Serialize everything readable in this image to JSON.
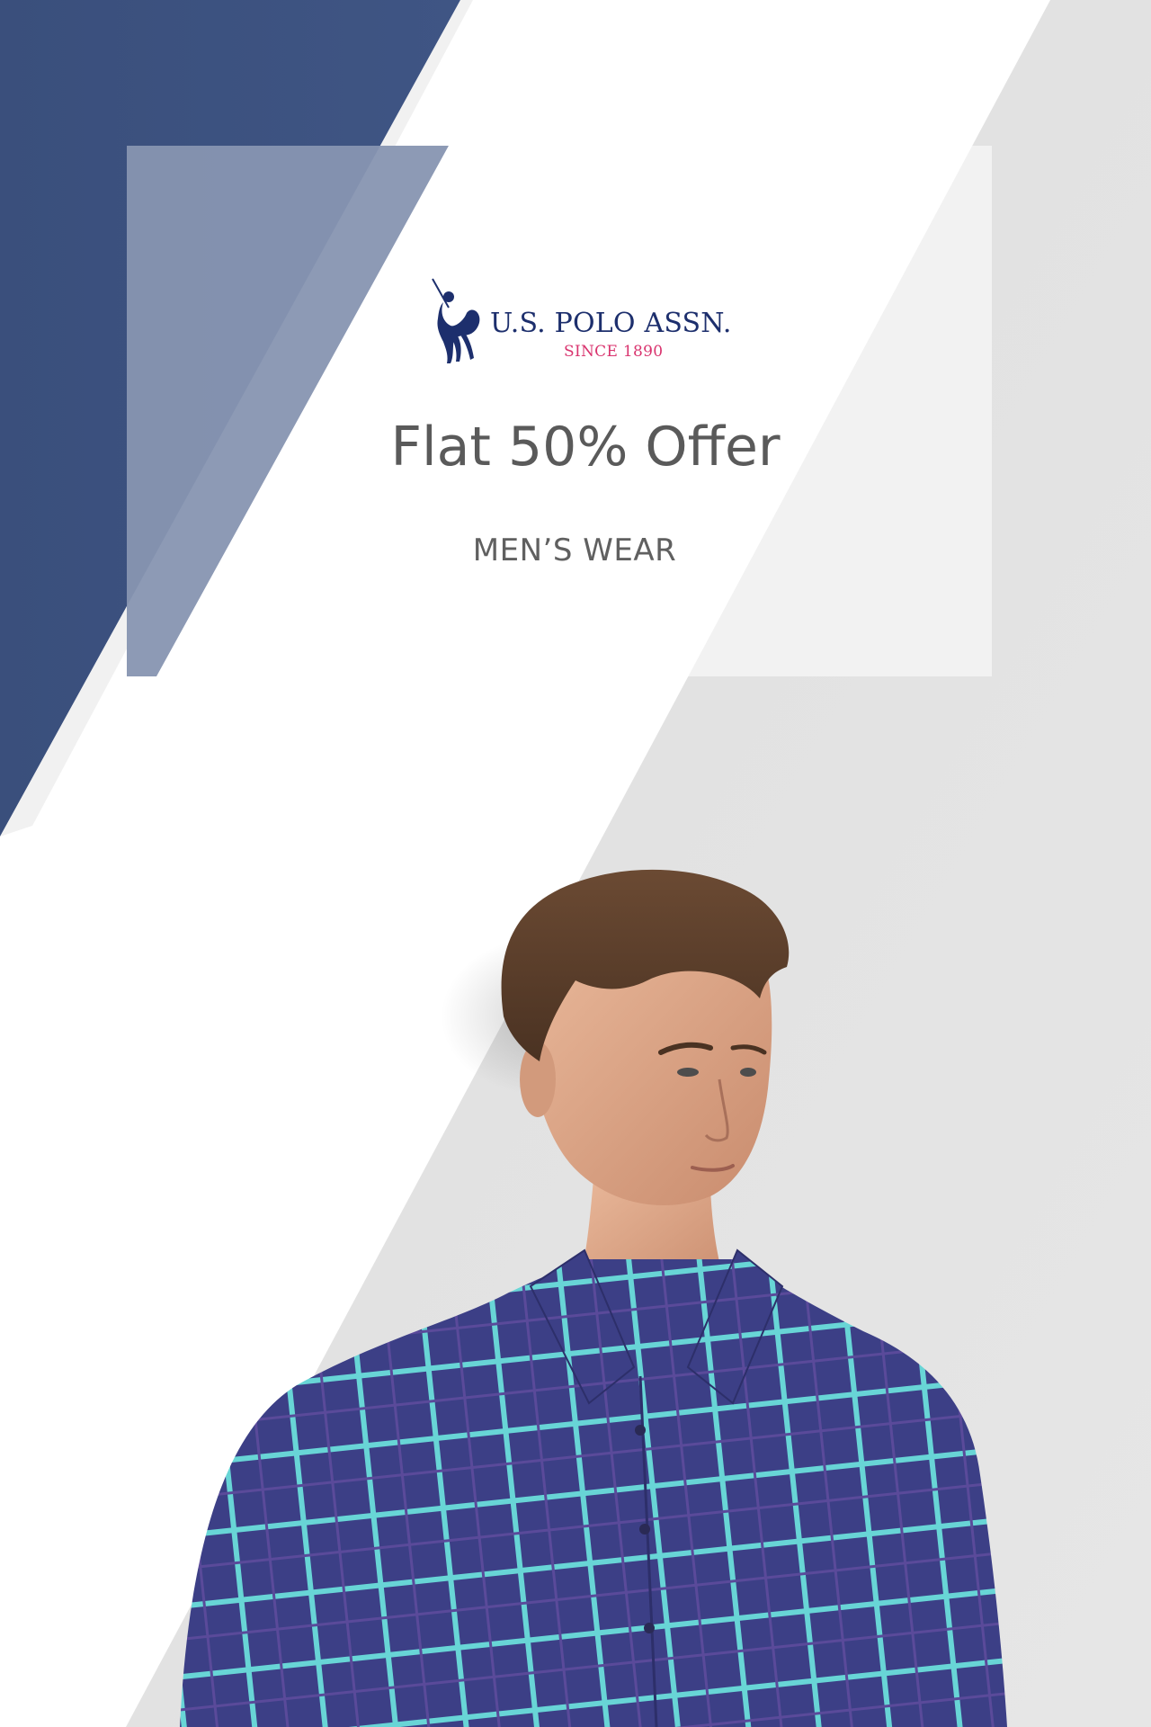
{
  "brand": {
    "name": "U.S. POLO ASSN.",
    "since": "SINCE 1890",
    "logo_icon": "polo-player-icon"
  },
  "offer": {
    "headline": "Flat 50% Offer",
    "category": "MEN’S WEAR"
  },
  "image": {
    "subject": "model-photo"
  },
  "colors": {
    "navy": "#3c5280",
    "panel": "#7f8eaa",
    "brand_navy": "#1d2f6d",
    "brand_pink": "#d9336e",
    "shirt": "#3c3f86",
    "shirt_check": "#68d5d6"
  }
}
